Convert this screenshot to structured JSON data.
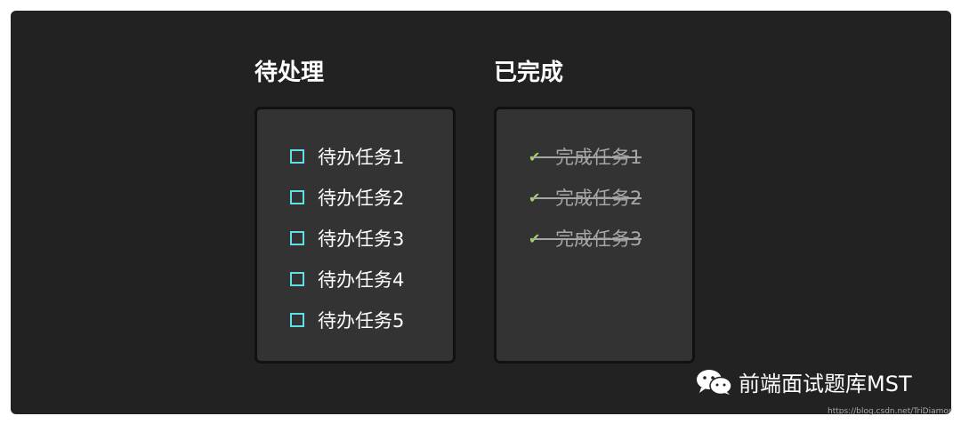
{
  "todo": {
    "title": "待处理",
    "items": [
      {
        "label": "待办任务1"
      },
      {
        "label": "待办任务2"
      },
      {
        "label": "待办任务3"
      },
      {
        "label": "待办任务4"
      },
      {
        "label": "待办任务5"
      }
    ]
  },
  "done": {
    "title": "已完成",
    "items": [
      {
        "label": "完成任务1"
      },
      {
        "label": "完成任务2"
      },
      {
        "label": "完成任务3"
      }
    ]
  },
  "watermark": {
    "text": "前端面试题库MST",
    "icon": "wechat-icon",
    "url": "https://blog.csdn.net/TriDiamond"
  },
  "colors": {
    "background": "#222222",
    "box": "#333333",
    "checkbox": "#5fe0e8",
    "check": "#a6d66a",
    "done_text": "#a6a6a6"
  }
}
